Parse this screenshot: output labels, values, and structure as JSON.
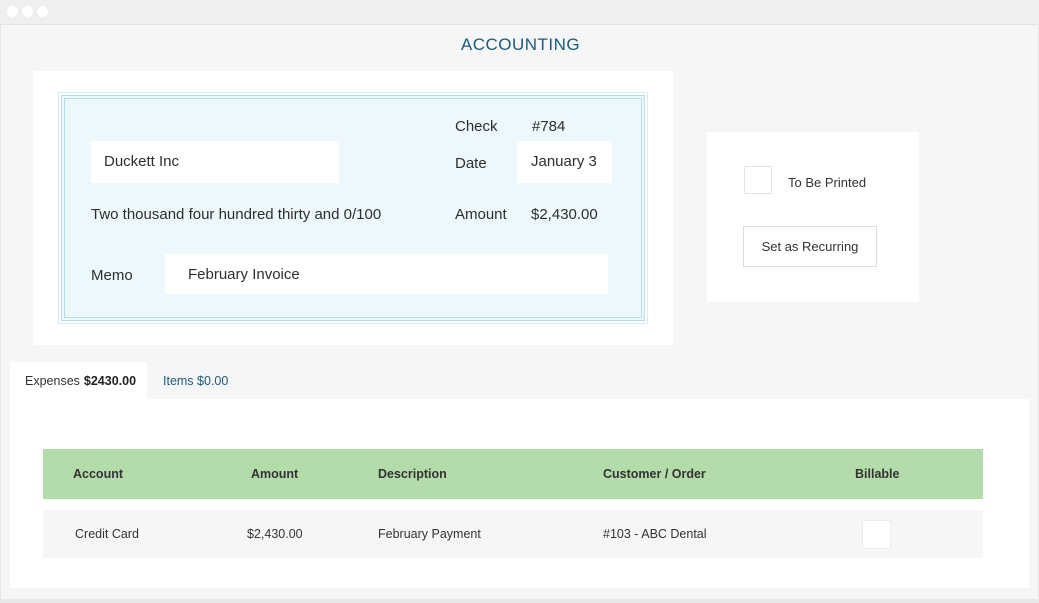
{
  "app": {
    "title": "ACCOUNTING"
  },
  "check": {
    "number_label": "Check",
    "number_value": "#784",
    "payee": "Duckett Inc",
    "date_label": "Date",
    "date_value": "January 3",
    "amount_words": "Two thousand four hundred thirty and 0/100",
    "amount_label": "Amount",
    "amount_value": "$2,430.00",
    "memo_label": "Memo",
    "memo_value": "February Invoice"
  },
  "options": {
    "to_be_printed_label": "To Be Printed",
    "to_be_printed_checked": false,
    "recurring_button": "Set as Recurring"
  },
  "tabs": [
    {
      "label": "Expenses",
      "amount": "$2430.00",
      "active": true
    },
    {
      "label": "Items $0.00",
      "active": false
    }
  ],
  "table": {
    "headers": [
      "Account",
      "Amount",
      "Description",
      "Customer / Order",
      "Billable"
    ],
    "rows": [
      {
        "account": "Credit Card",
        "amount": "$2,430.00",
        "description": "February Payment",
        "customer": "#103 - ABC Dental",
        "billable": false
      }
    ]
  },
  "colors": {
    "accent": "#1f5a78",
    "header_green": "#b3dcaa",
    "check_background": "#edf8fc",
    "check_border": "#b9dcec"
  }
}
